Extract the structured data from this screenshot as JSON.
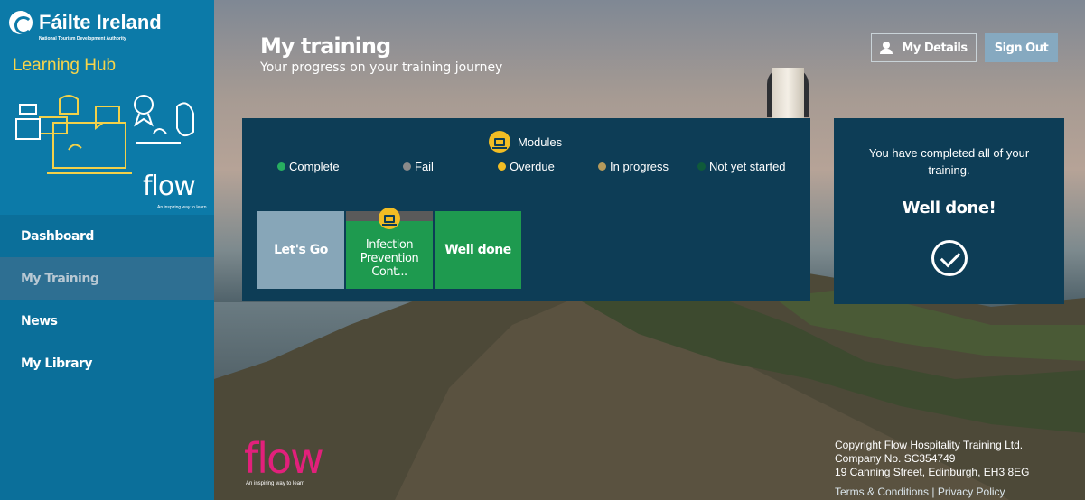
{
  "brand": {
    "name": "Fáilte Ireland",
    "tagline": "National Tourism Development Authority",
    "hub": "Learning Hub",
    "flow_logo": "flow",
    "flow_tagline": "An inspiring way to learn"
  },
  "nav": {
    "items": [
      {
        "label": "Dashboard"
      },
      {
        "label": "My Training"
      },
      {
        "label": "News"
      },
      {
        "label": "My Library"
      }
    ]
  },
  "header": {
    "title": "My training",
    "subtitle": "Your progress on your training journey",
    "my_details": "My Details",
    "sign_out": "Sign Out"
  },
  "modules": {
    "title": "Modules",
    "legend": [
      {
        "label": "Complete",
        "color": "#27ae60"
      },
      {
        "label": "Fail",
        "color": "#8a8a8a"
      },
      {
        "label": "Overdue",
        "color": "#f1bd24"
      },
      {
        "label": "In progress",
        "color": "#b59a5b"
      },
      {
        "label": "Not yet started",
        "color": "#0f5a3a"
      }
    ],
    "tiles": [
      {
        "label": "Let's Go"
      },
      {
        "label": "Infection Prevention Cont..."
      },
      {
        "label": "Well done"
      }
    ]
  },
  "completion": {
    "message": "You have completed all of your training.",
    "well_done": "Well done!"
  },
  "footer": {
    "copyright": "Copyright Flow Hospitality Training Ltd.",
    "company": "Company No. SC354749",
    "address": "19 Canning Street, Edinburgh, EH3 8EG",
    "terms": "Terms & Conditions",
    "separator": "|",
    "privacy": "Privacy Policy"
  }
}
